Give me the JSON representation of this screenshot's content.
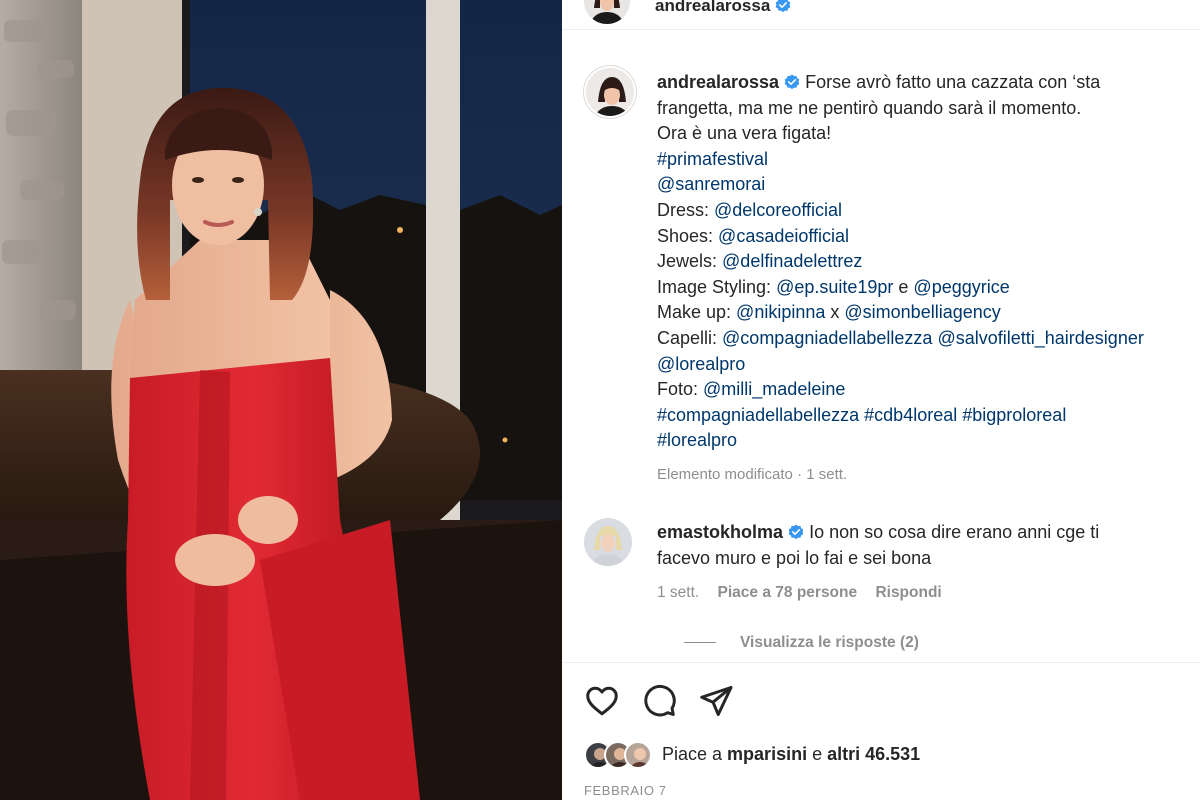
{
  "post": {
    "author": "andrealarossa",
    "caption": {
      "author": "andrealarossa",
      "lines": [
        "Forse avrò fatto una cazzata con ‘sta",
        "frangetta, ma me ne pentirò quando sarà il momento.",
        "Ora è una vera figata!"
      ],
      "hashtag1": "#primafestival",
      "mention1": "@sanremorai",
      "credits": [
        {
          "label": "Dress: ",
          "links": [
            "@delcoreofficial"
          ]
        },
        {
          "label": "Shoes: ",
          "links": [
            "@casadeiofficial"
          ]
        },
        {
          "label": "Jewels: ",
          "links": [
            "@delfinadelettrez"
          ]
        },
        {
          "label": "Image Styling: ",
          "links": [
            "@ep.suite19pr",
            " e ",
            "@peggyrice"
          ]
        },
        {
          "label": "Make up: ",
          "links": [
            "@nikipinna",
            " x ",
            "@simonbelliagency"
          ]
        },
        {
          "label": "Capelli: ",
          "links": [
            "@compagniadellabellezza",
            " ",
            "@salvofiletti_hairdesigner"
          ]
        }
      ],
      "mention_loreal": "@lorealpro",
      "foto_label": "Foto: ",
      "foto_link": "@milli_madeleine",
      "hashtags_line": [
        "#compagniadellabellezza",
        "#cdb4loreal",
        "#bigproloreal"
      ],
      "last_hashtag": "#lorealpro",
      "meta": "Elemento modificato · 1 sett."
    },
    "comment": {
      "author": "emastokholma",
      "text_line1": "Io non so cosa dire erano anni cge ti",
      "text_line2": "facevo muro e poi lo fai e sei bona",
      "time": "1 sett.",
      "likes": "Piace a 78 persone",
      "reply": "Rispondi",
      "view_replies": "Visualizza le risposte (2)"
    },
    "likes": {
      "prefix": "Piace a ",
      "user": "mparisini",
      "middle": " e ",
      "others": "altri 46.531"
    },
    "date": "FEBBRAIO 7"
  },
  "icons": {
    "like": "heart-icon",
    "comment": "comment-icon",
    "share": "share-icon",
    "verified": "verified-badge-icon"
  },
  "colors": {
    "link": "#00376b",
    "verified": "#3897f0",
    "dress": "#d8232f"
  }
}
